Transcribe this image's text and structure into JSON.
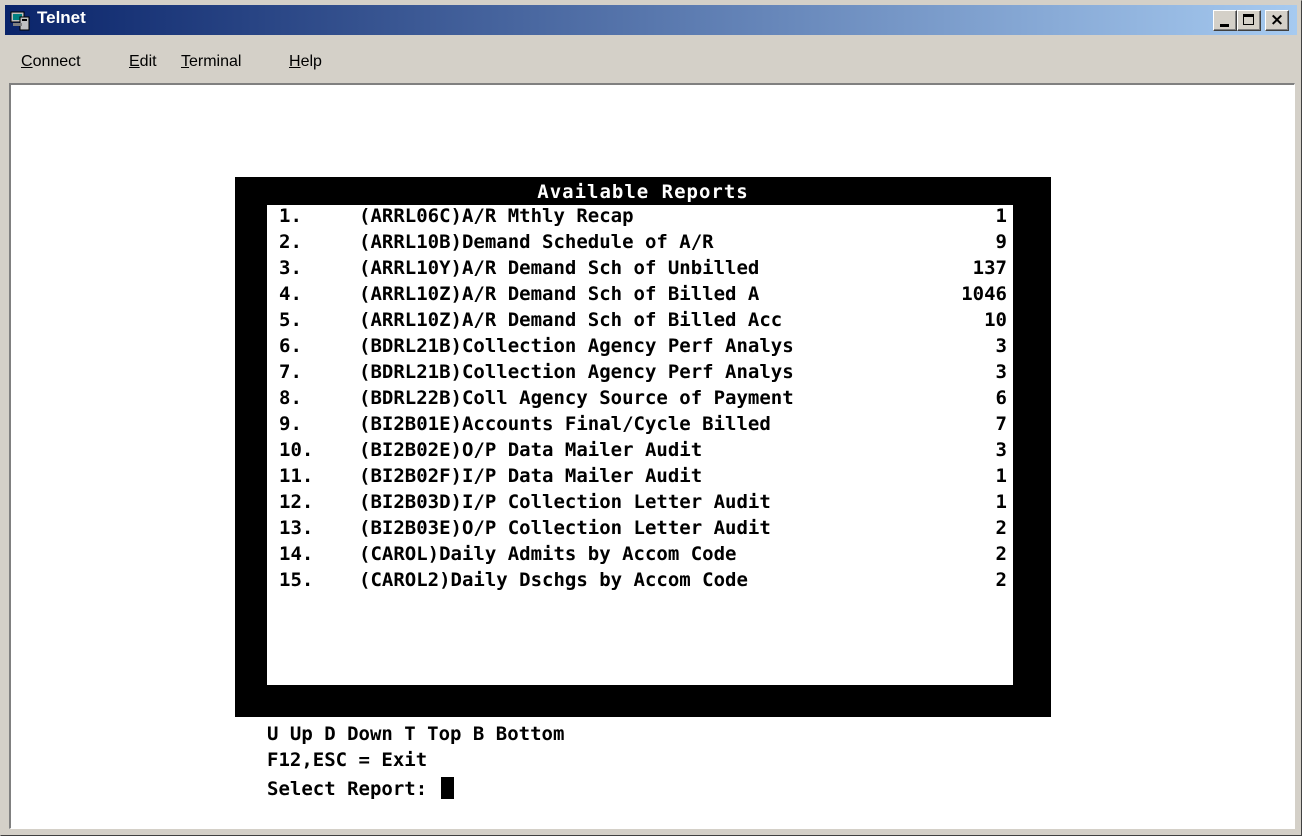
{
  "window": {
    "title": "Telnet",
    "icon": "computer-icon"
  },
  "controls": {
    "close_glyph": "×"
  },
  "menu": [
    {
      "accel": "C",
      "rest": "onnect"
    },
    {
      "accel": "E",
      "rest": "dit"
    },
    {
      "accel": "T",
      "rest": "erminal"
    },
    {
      "accel": "H",
      "rest": "elp"
    }
  ],
  "report": {
    "title": "Available Reports",
    "items": [
      {
        "num": "1.",
        "name": "(ARRL06C)A/R Mthly Recap",
        "count": "1"
      },
      {
        "num": "2.",
        "name": "(ARRL10B)Demand Schedule of A/R",
        "count": "9"
      },
      {
        "num": "3.",
        "name": "(ARRL10Y)A/R Demand Sch of Unbilled",
        "count": "137"
      },
      {
        "num": "4.",
        "name": "(ARRL10Z)A/R Demand Sch of Billed A",
        "count": "1046"
      },
      {
        "num": "5.",
        "name": "(ARRL10Z)A/R Demand Sch of Billed Acc",
        "count": "10"
      },
      {
        "num": "6.",
        "name": "(BDRL21B)Collection Agency Perf Analys",
        "count": "3"
      },
      {
        "num": "7.",
        "name": "(BDRL21B)Collection Agency Perf Analys",
        "count": "3"
      },
      {
        "num": "8.",
        "name": "(BDRL22B)Coll Agency Source of Payment",
        "count": "6"
      },
      {
        "num": "9.",
        "name": "(BI2B01E)Accounts Final/Cycle Billed",
        "count": "7"
      },
      {
        "num": "10.",
        "name": "(BI2B02E)O/P Data Mailer Audit",
        "count": "3"
      },
      {
        "num": "11.",
        "name": "(BI2B02F)I/P Data Mailer Audit",
        "count": "1"
      },
      {
        "num": "12.",
        "name": "(BI2B03D)I/P Collection Letter Audit",
        "count": "1"
      },
      {
        "num": "13.",
        "name": "(BI2B03E)O/P Collection Letter Audit",
        "count": "2"
      },
      {
        "num": "14.",
        "name": "(CAROL)Daily Admits by Accom Code",
        "count": "2"
      },
      {
        "num": "15.",
        "name": "(CAROL2)Daily Dschgs by Accom Code",
        "count": "2"
      }
    ]
  },
  "footer": {
    "nav_hint": "U Up D Down T Top B Bottom",
    "exit_hint": "F12,ESC = Exit",
    "prompt": "Select Report:"
  }
}
